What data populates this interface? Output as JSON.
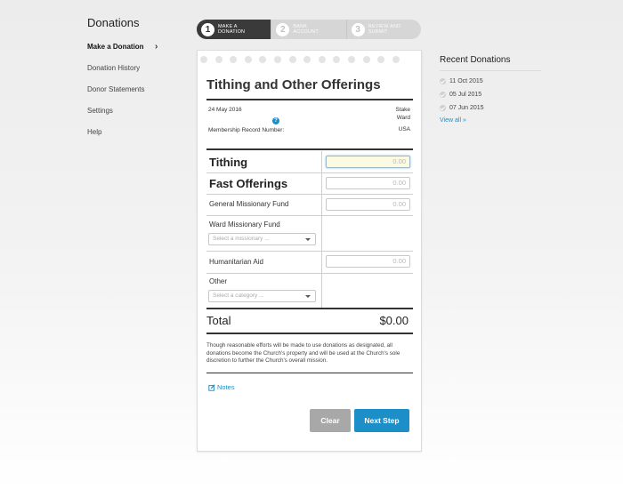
{
  "sidebar": {
    "title": "Donations",
    "items": [
      {
        "label": "Make a Donation",
        "chevron": "›"
      },
      {
        "label": "Donation History"
      },
      {
        "label": "Donor Statements"
      },
      {
        "label": "Settings"
      },
      {
        "label": "Help"
      }
    ]
  },
  "steps": [
    {
      "num": "1",
      "line1": "MAKE A",
      "line2": "DONATION"
    },
    {
      "num": "2",
      "line1": "BANK",
      "line2": "ACCOUNT"
    },
    {
      "num": "3",
      "line1": "REVIEW AND",
      "line2": "SUBMIT"
    }
  ],
  "form": {
    "title": "Tithing and Other Offerings",
    "date": "24 May 2016",
    "stake": "Stake",
    "ward": "Ward",
    "country": "USA",
    "membership_label": "Membership Record Number:",
    "help_glyph": "?",
    "tithing_label": "Tithing",
    "tithing_placeholder": "0.00",
    "fast_label": "Fast Offerings",
    "fast_placeholder": "0.00",
    "gmf_label": "General Missionary Fund",
    "gmf_placeholder": "0.00",
    "wmf_label": "Ward Missionary Fund",
    "wmf_select": "Select a missionary ...",
    "humanitarian_label": "Humanitarian Aid",
    "humanitarian_placeholder": "0.00",
    "other_label": "Other",
    "other_select": "Select a category ...",
    "total_label": "Total",
    "total_value": "$0.00",
    "disclaimer": "Though reasonable efforts will be made to use donations as designated, all donations become the Church's property and will be used at the Church's sole discretion to further the Church's overall mission.",
    "notes_label": "Notes",
    "clear_label": "Clear",
    "next_label": "Next Step"
  },
  "recent": {
    "title": "Recent Donations",
    "items": [
      "11 Oct 2015",
      "05 Jul 2015",
      "07 Jun 2015"
    ],
    "view_all": "View all »"
  },
  "colors": {
    "accent": "#1c8fc9",
    "dark": "#3a3a3a",
    "clear_button": "#a8a8a8"
  }
}
